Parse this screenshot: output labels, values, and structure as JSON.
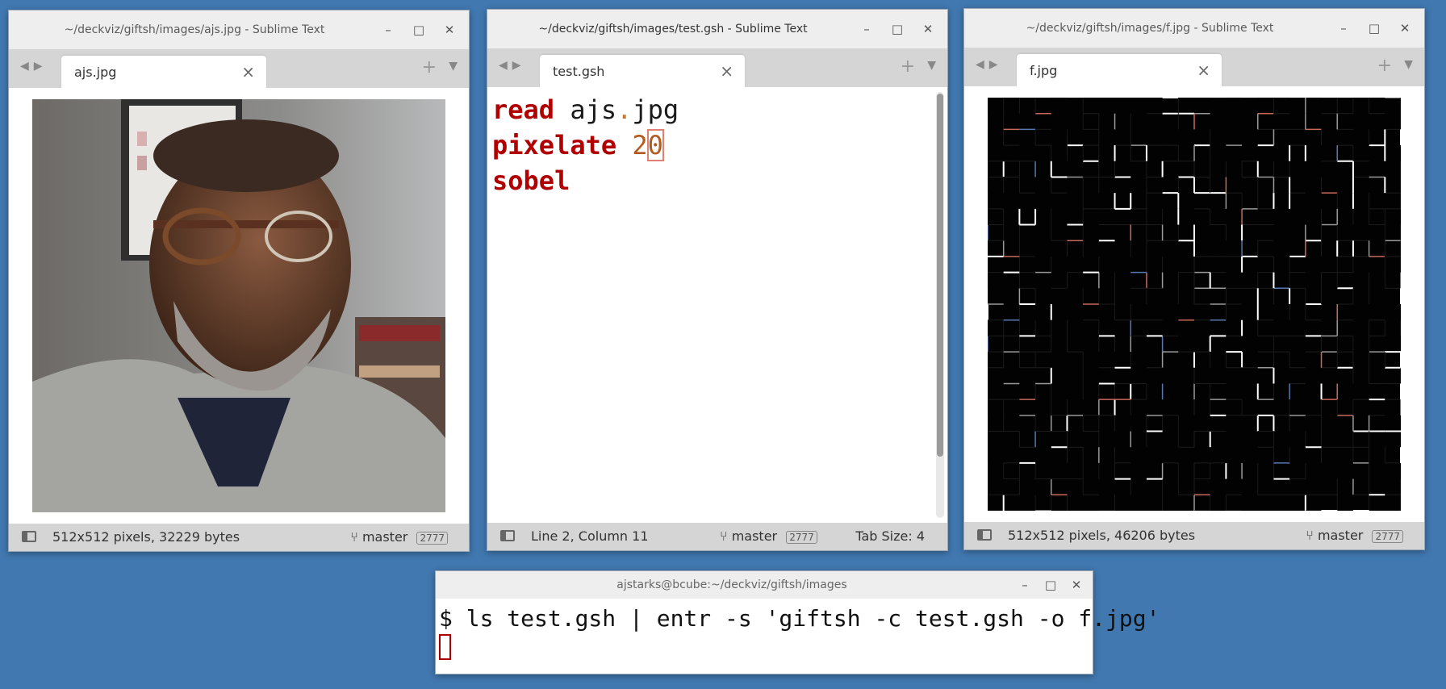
{
  "windows": {
    "left": {
      "title": "~/deckviz/giftsh/images/ajs.jpg - Sublime Text",
      "tab": "ajs.jpg",
      "status": "512x512 pixels, 32229 bytes",
      "branch": "master",
      "badge": "2777"
    },
    "middle": {
      "title": "~/deckviz/giftsh/images/test.gsh - Sublime Text",
      "tab": "test.gsh",
      "code": {
        "l1_kw": "read",
        "l1_a": "ajs",
        "l1_dot": ".",
        "l1_b": "jpg",
        "l2_kw": "pixelate",
        "l2_num1": "2",
        "l2_num2": "0",
        "l3_kw": "sobel"
      },
      "status": "Line 2, Column 11",
      "branch": "master",
      "badge": "2777",
      "tabsize": "Tab Size: 4"
    },
    "right": {
      "title": "~/deckviz/giftsh/images/f.jpg - Sublime Text",
      "tab": "f.jpg",
      "status": "512x512 pixels, 46206 bytes",
      "branch": "master",
      "badge": "2777"
    }
  },
  "terminal": {
    "title": "ajstarks@bcube:~/deckviz/giftsh/images",
    "line": "$ ls test.gsh | entr -s 'giftsh -c test.gsh -o f.jpg'"
  },
  "icons": {
    "minimize": "–",
    "maximize": "□",
    "close": "✕",
    "tab_close": "×",
    "plus": "+",
    "menu": "▼",
    "arrows": "◀▶",
    "branch": "⑂"
  }
}
